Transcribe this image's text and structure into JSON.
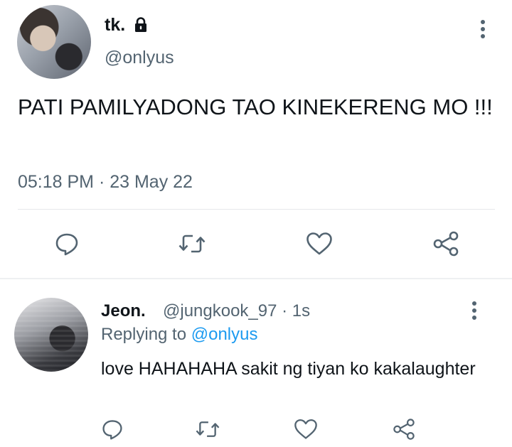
{
  "main_tweet": {
    "display_name": "tk.",
    "handle": "@onlyus",
    "text": "PATI PAMILYADONG TAO KINEKERENG MO !!!",
    "timestamp": "05:18 PM · 23 May 22",
    "icons": {
      "protected": "lock-icon",
      "more": "more-vertical-icon",
      "actions": [
        "reply-icon",
        "retweet-icon",
        "like-icon",
        "share-icon"
      ]
    }
  },
  "reply_tweet": {
    "display_name": "Jeon.",
    "meta": "@jungkook_97 · 1s",
    "replying_prefix": "Replying to ",
    "replying_mention": "@onlyus",
    "text": "love HAHAHAHA sakit ng tiyan ko kakalaughter",
    "icons": {
      "more": "more-vertical-icon",
      "actions": [
        "reply-icon",
        "retweet-icon",
        "like-icon",
        "share-icon"
      ]
    }
  },
  "colors": {
    "text": "#0f1419",
    "secondary": "#536471",
    "mention": "#1d9bf0",
    "divider": "#e6e8ea"
  }
}
